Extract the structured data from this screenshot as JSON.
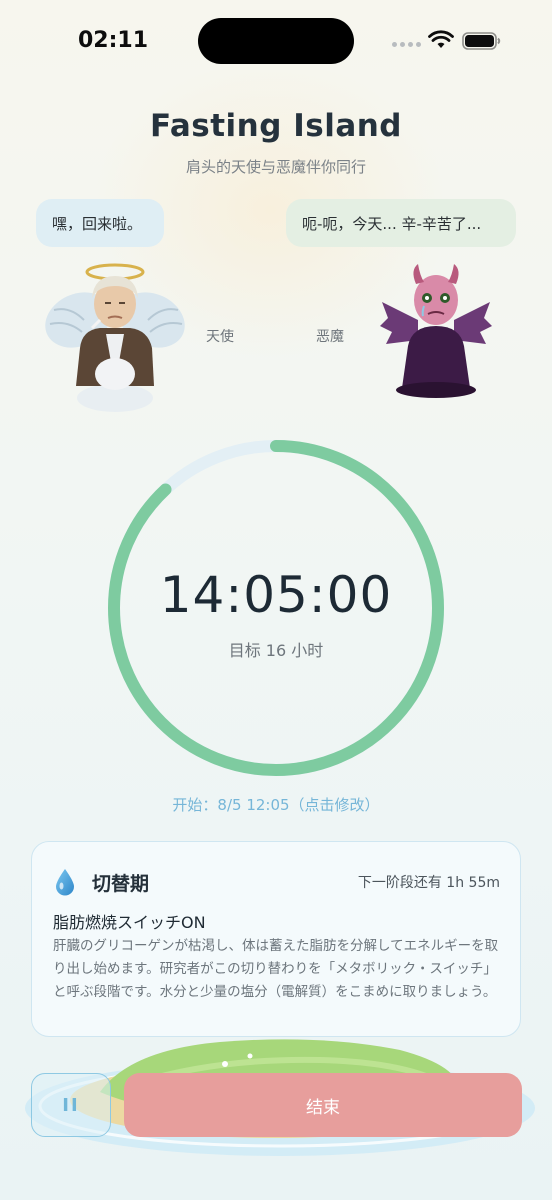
{
  "status_bar": {
    "time": "02:11"
  },
  "header": {
    "title": "Fasting Island",
    "subtitle": "肩头的天使与恶魔伴你同行"
  },
  "angel": {
    "speech": "嘿，回来啦。",
    "label": "天使"
  },
  "devil": {
    "speech": "呃-呃，今天... 辛-辛苦了...",
    "label": "恶魔"
  },
  "timer": {
    "elapsed": "14:05:00",
    "goal": "目标 16 小时",
    "progress": 0.8802,
    "start_text": "开始：8/5 12:05（点击修改）"
  },
  "phase_card": {
    "icon": "water-drop-icon",
    "phase": "切替期",
    "next": "下一阶段还有 1h 55m",
    "heading": "脂肪燃焼スイッチON",
    "body": "肝臓のグリコーゲンが枯渇し、体は蓄えた脂肪を分解してエネルギーを取り出し始めます。研究者がこの切り替わりを「メタボリック・スイッチ」と呼ぶ段階です。水分と少量の塩分（電解質）をこまめに取りましょう。"
  },
  "controls": {
    "pause_label": "II",
    "end_label": "结束"
  },
  "colors": {
    "ring_progress": "#7ecba0",
    "ring_track": "#e3eff5",
    "end_button": "#e79e9c",
    "accent_link": "#76b6d8"
  }
}
